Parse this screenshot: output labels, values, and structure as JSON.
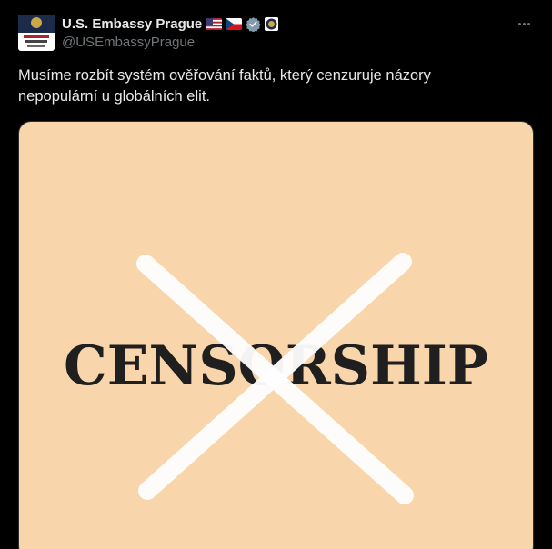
{
  "author": {
    "name": "U.S. Embassy Prague",
    "handle": "@USEmbassyPrague",
    "flags": [
      "us-flag-icon",
      "czech-flag-icon"
    ],
    "verified_icon": "verified-badge-icon",
    "affiliate_icon": "state-department-seal-icon"
  },
  "tweet": {
    "text_line1": "Musíme rozbít systém ověřování faktů, který cenzuruje názory",
    "text_line2": "nepopulární u globálních elit."
  },
  "media": {
    "word": "CENSORSHIP",
    "background_color": "#f8d5aa",
    "text_color": "#1f1f1f",
    "cross_color": "#ffffff"
  },
  "menu": {
    "more_icon": "more-horizontal-icon"
  },
  "colors": {
    "background": "#000000",
    "primary_text": "#e7e9ea",
    "secondary_text": "#71767b",
    "verified_blue": "#829aab"
  }
}
